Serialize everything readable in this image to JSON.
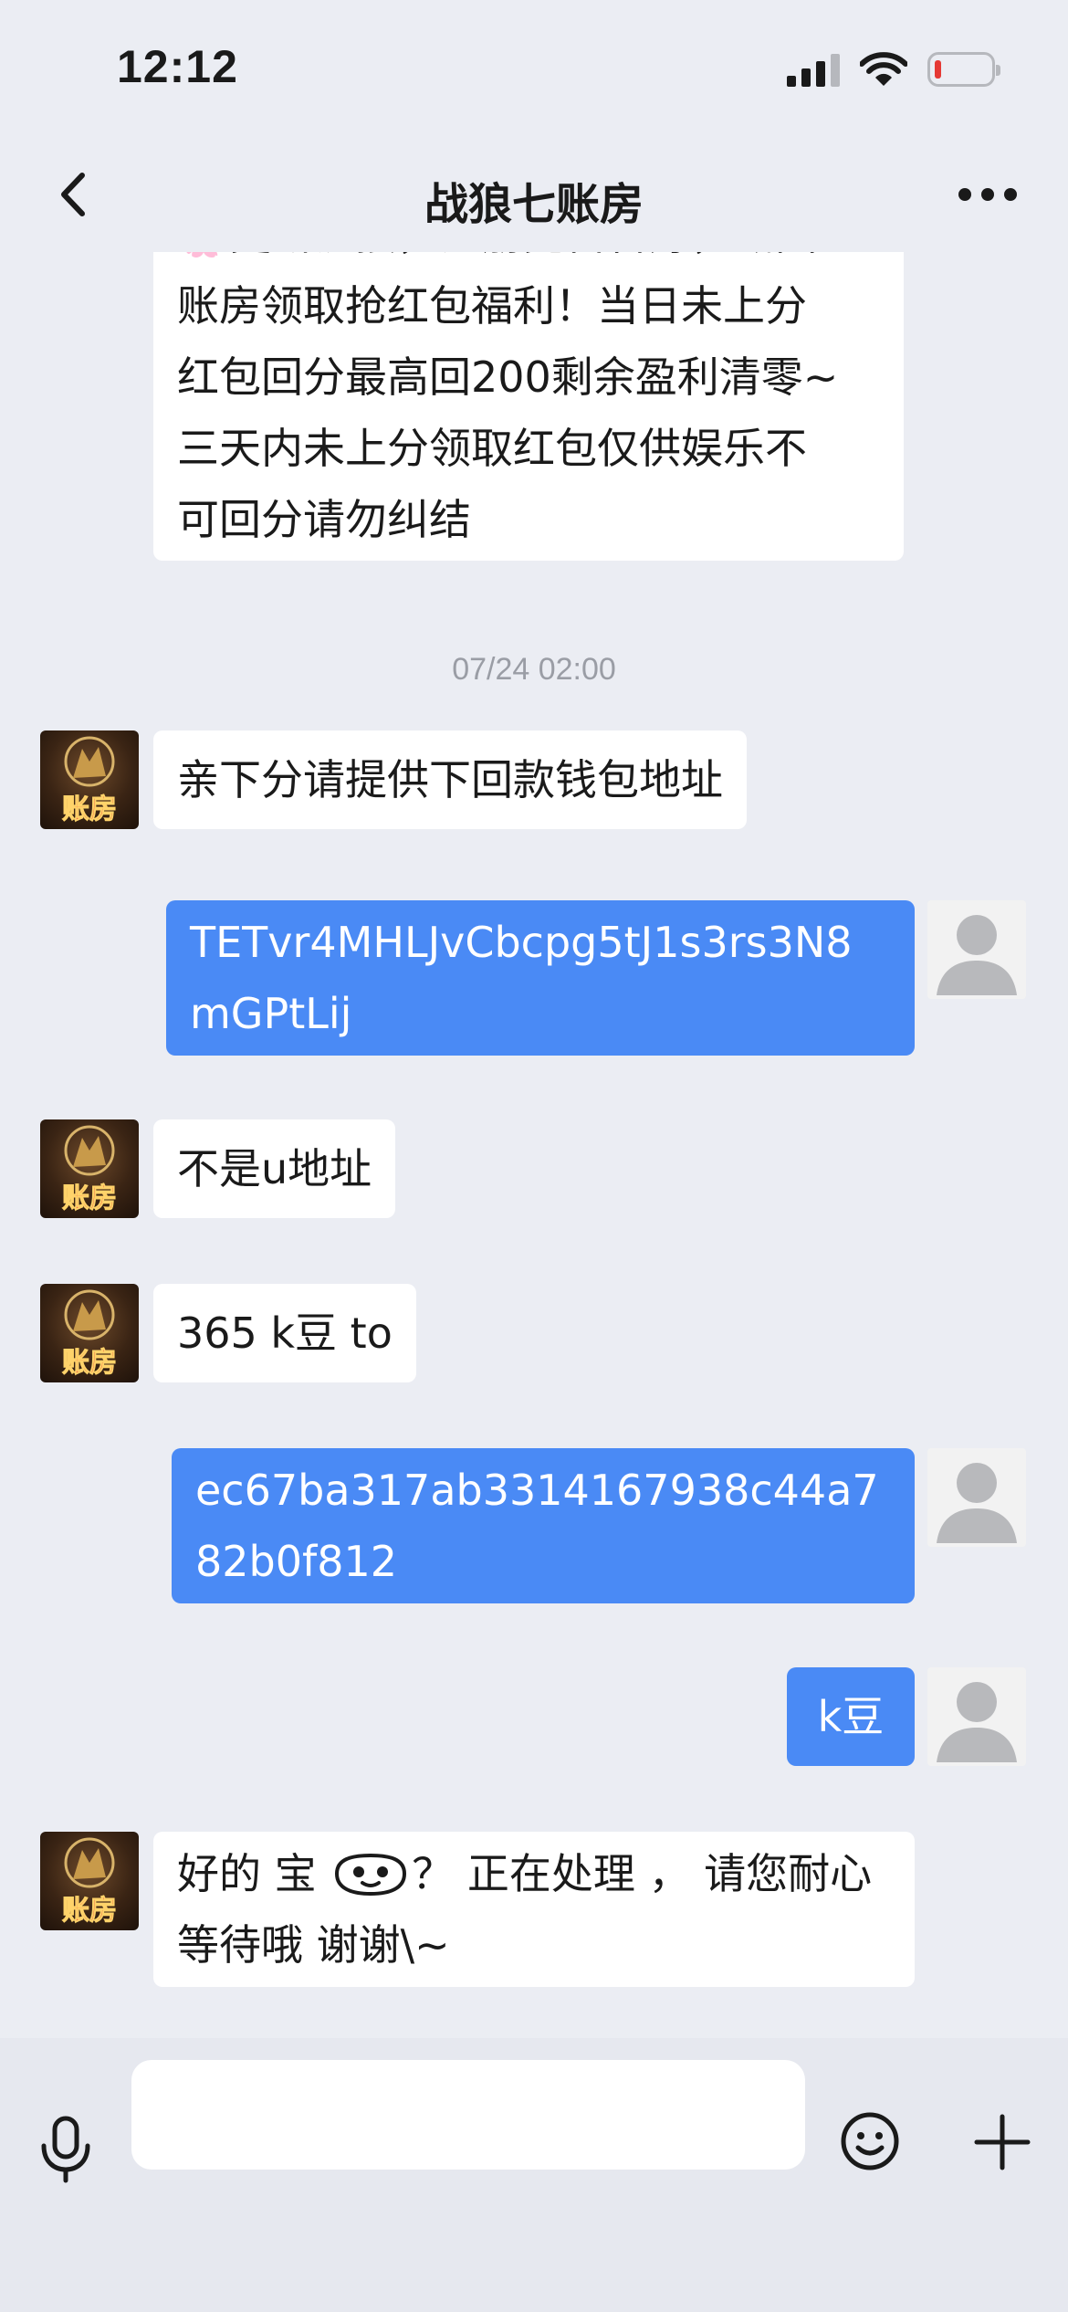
{
  "status_bar": {
    "time": "12:12"
  },
  "header": {
    "title": "战狼七账房",
    "back_icon": "chevron-left-icon",
    "more_icon": "more-dots-icon"
  },
  "messages": [
    {
      "sender": "brand",
      "lines": [
        "🌸更新链接，注册完留言好，截图",
        "账房领取抢红包福利！当日未上分",
        "红包回分最高回200剩余盈利清零~",
        "三天内未上分领取红包仅供娱乐不",
        "可回分请勿纠结"
      ]
    },
    {
      "type": "timestamp",
      "text": "07/24 02:00"
    },
    {
      "sender": "brand",
      "text": "亲下分请提供下回款钱包地址"
    },
    {
      "sender": "user",
      "lines": [
        "TETvr4MHLJvCbcpg5tJ1s3rs3N8",
        "mGPtLij"
      ]
    },
    {
      "sender": "brand",
      "text": "不是u地址"
    },
    {
      "sender": "brand",
      "text": "365 k豆 to"
    },
    {
      "sender": "user",
      "lines": [
        "ec67ba317ab3314167938c44a7",
        "82b0f812"
      ]
    },
    {
      "sender": "user",
      "text": "k豆"
    },
    {
      "sender": "brand",
      "line1_a": "好的 宝 ",
      "line1_b": "？ 正在处理 ， 请您耐心",
      "line2": "等待哦 谢谢\\~",
      "emoji": "grinning-face-icon"
    }
  ],
  "avatars": {
    "brand_text": "账房",
    "brand_seal": "战狼",
    "user_icon": "default-person-icon"
  },
  "input_bar": {
    "placeholder": "",
    "mic_icon": "microphone-icon",
    "emoji_icon": "smiley-icon",
    "plus_icon": "plus-icon"
  },
  "colors": {
    "background": "#ebedf3",
    "outgoing_bubble": "#4a8af5",
    "incoming_bubble": "#ffffff",
    "timestamp": "#9a9da5"
  }
}
